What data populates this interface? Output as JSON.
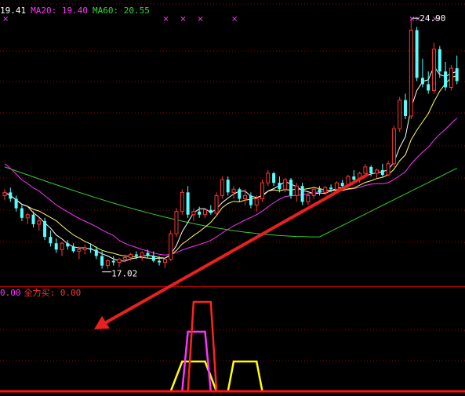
{
  "colors": {
    "background": "#000000",
    "up": "#ff3333",
    "down": "#55ffff",
    "grid": "#a00000",
    "ma5": "#ffffff",
    "ma10": "#ffff66",
    "ma20": "#ff33ff",
    "ma60": "#33cc33",
    "marker": "#ff44ff",
    "arrow": "#e82020"
  },
  "legend": {
    "ma10_value": "19.41",
    "ma20_text": "MA20: 19.40",
    "ma60_text": "MA60: 20.55"
  },
  "price_labels": {
    "high": "24.90",
    "low": "17.02"
  },
  "indicator_legend": {
    "first_value": "0.00",
    "buy_text": "全力买: 0.00"
  },
  "chart_data": {
    "type": "candlestick",
    "ylim": [
      16.5,
      25.2
    ],
    "candles": [
      [
        19.3,
        19.5,
        19.15,
        19.4
      ],
      [
        19.4,
        19.55,
        19.1,
        19.2
      ],
      [
        19.2,
        19.3,
        18.8,
        18.9
      ],
      [
        18.9,
        19.0,
        18.5,
        18.6
      ],
      [
        18.6,
        18.75,
        18.4,
        18.7
      ],
      [
        18.7,
        18.8,
        18.3,
        18.4
      ],
      [
        18.4,
        18.6,
        18.2,
        18.5
      ],
      [
        18.5,
        18.6,
        17.9,
        18.0
      ],
      [
        18.0,
        18.2,
        17.7,
        17.8
      ],
      [
        17.8,
        17.95,
        17.5,
        17.6
      ],
      [
        17.6,
        17.85,
        17.4,
        17.8
      ],
      [
        17.8,
        17.9,
        17.6,
        17.7
      ],
      [
        17.7,
        17.8,
        17.5,
        17.55
      ],
      [
        17.55,
        17.7,
        17.3,
        17.6
      ],
      [
        17.6,
        17.75,
        17.45,
        17.65
      ],
      [
        17.65,
        17.8,
        17.5,
        17.6
      ],
      [
        17.6,
        17.7,
        17.3,
        17.4
      ],
      [
        17.4,
        17.55,
        17.0,
        17.1
      ],
      [
        17.1,
        17.3,
        17.0,
        17.25
      ],
      [
        17.25,
        17.4,
        17.1,
        17.2
      ],
      [
        17.2,
        17.35,
        17.05,
        17.3
      ],
      [
        17.3,
        17.45,
        17.2,
        17.35
      ],
      [
        17.35,
        17.5,
        17.25,
        17.45
      ],
      [
        17.45,
        17.55,
        17.3,
        17.4
      ],
      [
        17.4,
        17.55,
        17.25,
        17.5
      ],
      [
        17.5,
        17.6,
        17.35,
        17.4
      ],
      [
        17.4,
        17.55,
        17.2,
        17.25
      ],
      [
        17.25,
        17.4,
        17.1,
        17.2
      ],
      [
        17.2,
        17.35,
        17.02,
        17.3
      ],
      [
        17.3,
        18.2,
        17.25,
        18.1
      ],
      [
        18.1,
        18.9,
        18.0,
        18.8
      ],
      [
        18.8,
        19.5,
        18.7,
        19.4
      ],
      [
        19.4,
        19.6,
        18.6,
        18.7
      ],
      [
        18.7,
        18.9,
        18.5,
        18.8
      ],
      [
        18.8,
        18.95,
        18.6,
        18.7
      ],
      [
        18.7,
        18.9,
        18.6,
        18.85
      ],
      [
        18.85,
        19.0,
        18.7,
        18.75
      ],
      [
        18.75,
        19.4,
        18.7,
        19.3
      ],
      [
        19.3,
        19.9,
        19.2,
        19.8
      ],
      [
        19.8,
        19.9,
        19.3,
        19.4
      ],
      [
        19.4,
        19.6,
        19.2,
        19.5
      ],
      [
        19.5,
        19.55,
        19.1,
        19.2
      ],
      [
        19.2,
        19.5,
        19.0,
        19.3
      ],
      [
        19.3,
        19.4,
        18.9,
        19.0
      ],
      [
        19.0,
        19.3,
        18.8,
        19.2
      ],
      [
        19.2,
        19.8,
        19.1,
        19.7
      ],
      [
        19.7,
        20.1,
        19.6,
        20.0
      ],
      [
        20.0,
        20.05,
        19.6,
        19.7
      ],
      [
        19.7,
        19.9,
        19.4,
        19.5
      ],
      [
        19.5,
        19.85,
        19.4,
        19.8
      ],
      [
        19.8,
        19.85,
        19.2,
        19.3
      ],
      [
        19.3,
        19.7,
        19.1,
        19.6
      ],
      [
        19.6,
        19.7,
        19.0,
        19.1
      ],
      [
        19.1,
        19.4,
        19.0,
        19.3
      ],
      [
        19.3,
        19.6,
        19.2,
        19.5
      ],
      [
        19.5,
        19.6,
        19.3,
        19.4
      ],
      [
        19.4,
        19.6,
        19.3,
        19.55
      ],
      [
        19.55,
        19.65,
        19.4,
        19.5
      ],
      [
        19.5,
        19.75,
        19.4,
        19.7
      ],
      [
        19.7,
        19.8,
        19.5,
        19.6
      ],
      [
        19.6,
        19.95,
        19.55,
        19.9
      ],
      [
        19.9,
        20.1,
        19.7,
        19.8
      ],
      [
        19.8,
        20.05,
        19.7,
        20.0
      ],
      [
        20.0,
        20.3,
        19.9,
        20.2
      ],
      [
        20.2,
        20.25,
        19.9,
        20.0
      ],
      [
        20.0,
        20.15,
        19.85,
        20.1
      ],
      [
        20.1,
        20.3,
        19.9,
        19.95
      ],
      [
        19.95,
        20.4,
        19.9,
        20.3
      ],
      [
        20.3,
        21.5,
        20.2,
        21.4
      ],
      [
        21.4,
        22.4,
        21.3,
        22.3
      ],
      [
        22.3,
        22.5,
        21.7,
        21.8
      ],
      [
        21.8,
        24.9,
        21.7,
        24.5
      ],
      [
        24.5,
        24.6,
        22.9,
        23.0
      ],
      [
        23.0,
        23.6,
        22.7,
        22.8
      ],
      [
        22.8,
        23.2,
        22.5,
        22.6
      ],
      [
        22.6,
        24.1,
        22.5,
        23.9
      ],
      [
        23.9,
        24.0,
        23.0,
        23.2
      ],
      [
        23.2,
        23.5,
        22.6,
        22.7
      ],
      [
        22.7,
        23.4,
        22.6,
        23.3
      ],
      [
        23.3,
        23.7,
        22.8,
        22.9
      ]
    ],
    "high_label_index": 71,
    "low_label_index": 17,
    "marker_indices": [
      0,
      28,
      31,
      34,
      40,
      71,
      72,
      75
    ],
    "indicator": {
      "ylim": [
        0,
        3
      ],
      "series": [
        {
          "color": "#ffff00",
          "trapezoids": [
            [
              29,
              37,
              31,
              35,
              1
            ],
            [
              39,
              45,
              40,
              44,
              1
            ]
          ]
        },
        {
          "color": "#ff33ff",
          "trapezoids": [
            [
              31,
              36,
              32,
              35,
              2
            ]
          ]
        },
        {
          "color": "#ff2222",
          "trapezoids": [
            [
              32,
              37,
              33,
              36,
              3
            ]
          ]
        }
      ]
    }
  }
}
